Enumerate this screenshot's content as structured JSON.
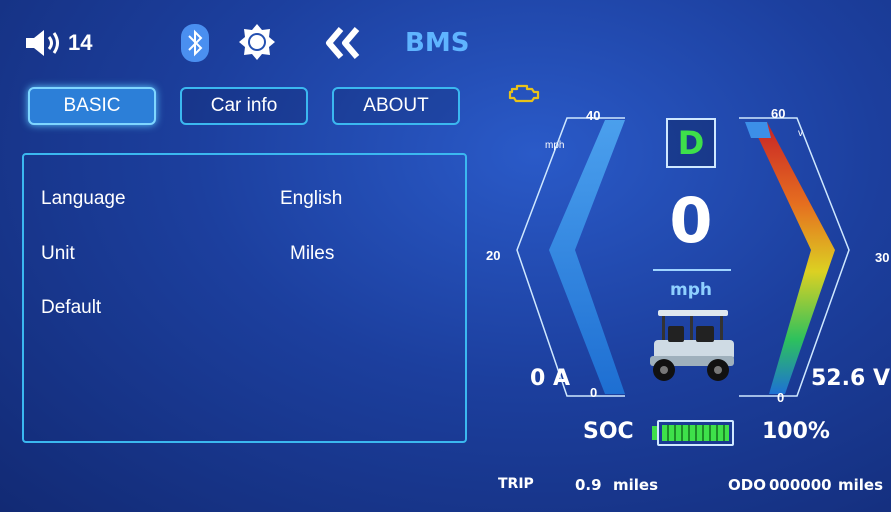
{
  "topbar": {
    "volume_level": "14",
    "bms_label": "BMS"
  },
  "tabs": [
    {
      "label": "BASIC"
    },
    {
      "label": "Car info"
    },
    {
      "label": "ABOUT"
    }
  ],
  "settings": [
    {
      "label": "Language",
      "value": "English"
    },
    {
      "label": "Unit",
      "value": "Miles"
    },
    {
      "label": "Default",
      "value": ""
    }
  ],
  "dashboard": {
    "gear": "D",
    "speed": "0",
    "speed_unit": "mph",
    "left_gauge": {
      "unit": "mph",
      "max": "40",
      "mid": "20",
      "min": "0"
    },
    "right_gauge": {
      "unit": "v",
      "max": "60",
      "mid": "30",
      "min": "0"
    },
    "current": "0 A",
    "voltage": "52.6 V",
    "soc_label": "SOC",
    "soc_value": "100%",
    "soc_fraction": 1.0,
    "trip_label": "TRIP",
    "trip_value": "0.9",
    "trip_unit": "miles",
    "odo_label": "ODO",
    "odo_value": "000000",
    "odo_unit": "miles"
  },
  "colors": {
    "accent": "#3bb8f0",
    "gear": "#3ee04a",
    "warning": "#e8c21a"
  }
}
